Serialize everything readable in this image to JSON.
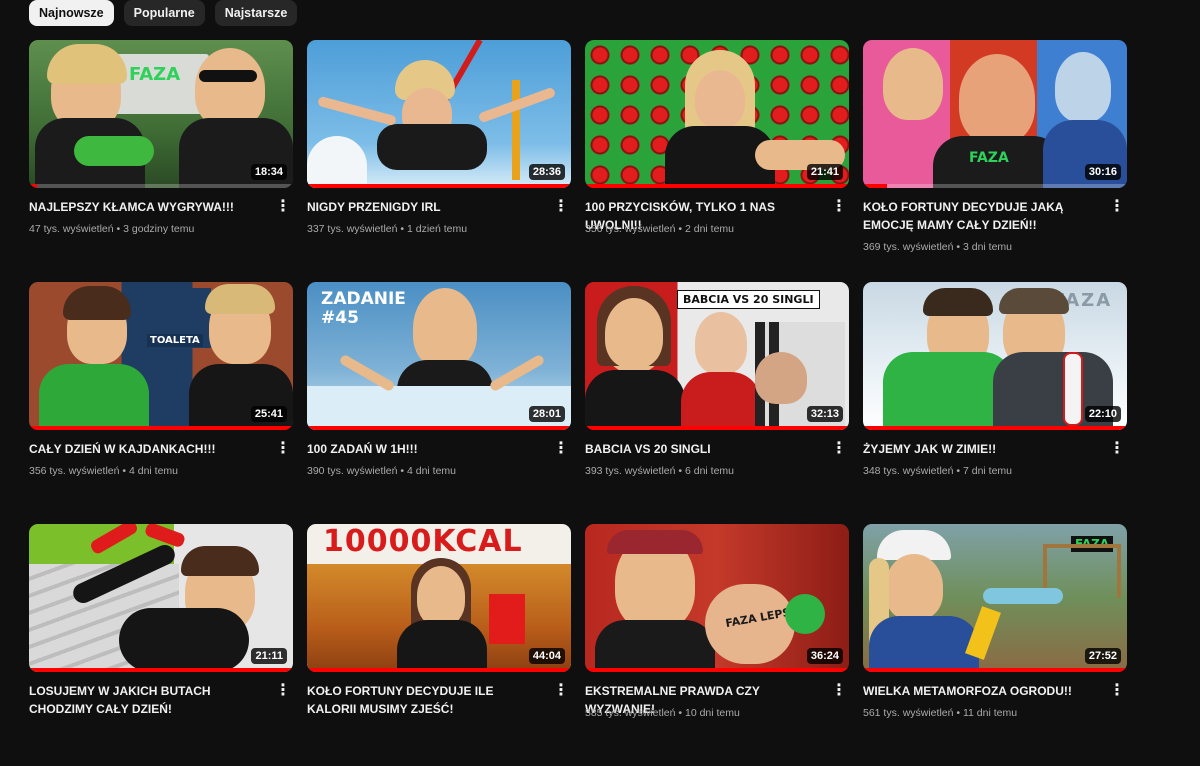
{
  "filters": [
    {
      "label": "Najnowsze",
      "active": true
    },
    {
      "label": "Popularne",
      "active": false
    },
    {
      "label": "Najstarsze",
      "active": false
    }
  ],
  "videos": [
    {
      "title": "NAJLEPSZY KŁAMCA WYGRYWA!!!",
      "views": "47 tys. wyświetleń",
      "age": "3 godziny temu",
      "duration": "18:34",
      "watched": 0.03,
      "thumb_text": "FAZA"
    },
    {
      "title": "NIGDY PRZENIGDY IRL",
      "views": "337 tys. wyświetleń",
      "age": "1 dzień temu",
      "duration": "28:36",
      "watched": 1.0,
      "thumb_text": ""
    },
    {
      "title": "100 PRZYCISKÓW, TYLKO 1 NAS UWOLNI!!",
      "views": "356 tys. wyświetleń",
      "age": "2 dni temu",
      "duration": "21:41",
      "watched": 1.0,
      "thumb_text": ""
    },
    {
      "title": "KOŁO FORTUNY DECYDUJE JAKĄ EMOCJĘ MAMY CAŁY DZIEŃ!!",
      "views": "369 tys. wyświetleń",
      "age": "3 dni temu",
      "duration": "30:16",
      "watched": 0.09,
      "thumb_text": "FAZA"
    },
    {
      "title": "CAŁY DZIEŃ W KAJDANKACH!!!",
      "views": "356 tys. wyświetleń",
      "age": "4 dni temu",
      "duration": "25:41",
      "watched": 1.0,
      "thumb_text": "TOALETA"
    },
    {
      "title": "100 ZADAŃ W 1H!!!",
      "views": "390 tys. wyświetleń",
      "age": "4 dni temu",
      "duration": "28:01",
      "watched": 1.0,
      "thumb_text": "ZADANIE #45"
    },
    {
      "title": "BABCIA VS 20 SINGLI",
      "views": "393 tys. wyświetleń",
      "age": "6 dni temu",
      "duration": "32:13",
      "watched": 1.0,
      "thumb_text": "BABCIA VS 20 SINGLI"
    },
    {
      "title": "ŻYJEMY JAK W ZIMIE!!",
      "views": "348 tys. wyświetleń",
      "age": "7 dni temu",
      "duration": "22:10",
      "watched": 1.0,
      "thumb_text": "FAZA"
    },
    {
      "title": "LOSUJEMY W JAKICH BUTACH CHODZIMY CAŁY DZIEŃ!",
      "views": "",
      "age": "",
      "duration": "21:11",
      "watched": 1.0,
      "thumb_text": ""
    },
    {
      "title": "KOŁO FORTUNY DECYDUJE ILE KALORII MUSIMY ZJEŚĆ!",
      "views": "",
      "age": "",
      "duration": "44:04",
      "watched": 1.0,
      "thumb_text": "10000KCAL"
    },
    {
      "title": "EKSTREMALNE PRAWDA CZY WYZWANIE!",
      "views": "585 tys. wyświetleń",
      "age": "10 dni temu",
      "duration": "36:24",
      "watched": 1.0,
      "thumb_text": "FAZA LEPSZA"
    },
    {
      "title": "WIELKA METAMORFOZA OGRODU!!",
      "views": "561 tys. wyświetleń",
      "age": "11 dni temu",
      "duration": "27:52",
      "watched": 1.0,
      "thumb_text": "FAZA"
    }
  ],
  "menu_icon": "kebab-vertical-icon",
  "colors": {
    "background": "#0f0f0f",
    "progress": "#ff0000",
    "chip": "#272727",
    "chip_active": "#f1f1f1",
    "meta": "#aaaaaa"
  }
}
